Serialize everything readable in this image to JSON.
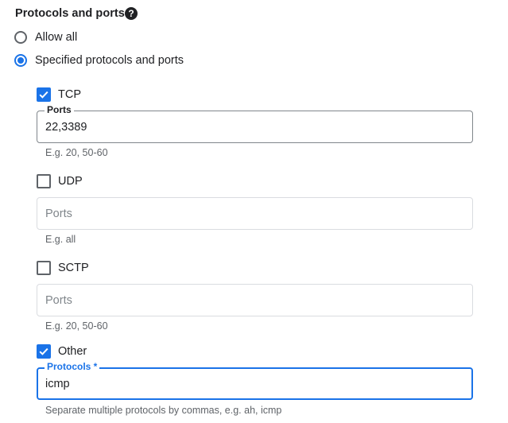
{
  "section": {
    "title": "Protocols and ports",
    "help_icon": "?"
  },
  "radios": {
    "allow_all": {
      "label": "Allow all",
      "checked": false
    },
    "specified": {
      "label": "Specified protocols and ports",
      "checked": true
    }
  },
  "tcp": {
    "label": "TCP",
    "checked": true,
    "field_label": "Ports",
    "value": "22,3389",
    "hint": "E.g. 20, 50-60"
  },
  "udp": {
    "label": "UDP",
    "checked": false,
    "placeholder": "Ports",
    "hint": "E.g. all"
  },
  "sctp": {
    "label": "SCTP",
    "checked": false,
    "placeholder": "Ports",
    "hint": "E.g. 20, 50-60"
  },
  "other": {
    "label": "Other",
    "checked": true,
    "field_label": "Protocols *",
    "value": "icmp",
    "hint": "Separate multiple protocols by commas, e.g. ah, icmp"
  },
  "colors": {
    "accent": "#1a73e8",
    "text": "#202124",
    "hint": "#5f6368"
  }
}
